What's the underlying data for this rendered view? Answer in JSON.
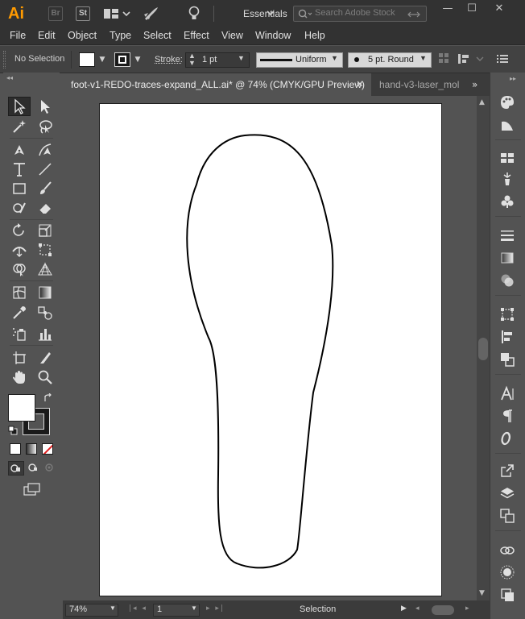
{
  "app": {
    "logo": "Ai",
    "bridge_tile": "Br",
    "stock_tile": "St",
    "workspace": "Essentials",
    "search_placeholder": "Search Adobe Stock"
  },
  "window_controls": {
    "minimize": "—",
    "maximize": "☐",
    "close": "✕"
  },
  "menu": [
    "File",
    "Edit",
    "Object",
    "Type",
    "Select",
    "Effect",
    "View",
    "Window",
    "Help"
  ],
  "control_bar": {
    "selection": "No Selection",
    "stroke_label": "Stroke:",
    "stroke_weight": "1 pt",
    "profile": "Uniform",
    "brush": "5 pt. Round"
  },
  "tabs": [
    {
      "title": "foot-v1-REDO-traces-expand_ALL.ai* @ 74% (CMYK/GPU Preview)",
      "active": true
    },
    {
      "title": "hand-v3-laser_mol",
      "active": false
    }
  ],
  "status_bar": {
    "zoom": "74%",
    "artboard_number": "1",
    "current_tool": "Selection"
  },
  "colors": {
    "accent": "#ff9a00",
    "chrome_dark": "#323232",
    "panel": "#535353",
    "fill_swatch": "#ffffff",
    "stroke_swatch": "#000000"
  }
}
